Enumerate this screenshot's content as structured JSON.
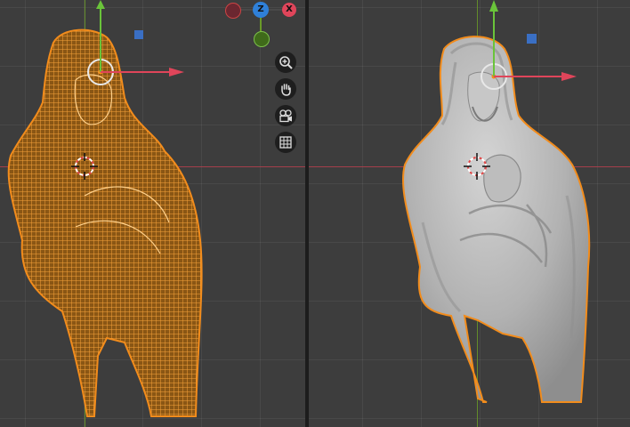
{
  "left_viewport": {
    "shading": "wireframe",
    "gizmo": {
      "z_label": "Z",
      "x_label": "X"
    },
    "nav_buttons": [
      {
        "name": "zoom-button",
        "icon": "zoom-icon"
      },
      {
        "name": "pan-button",
        "icon": "hand-icon"
      },
      {
        "name": "camera-view-button",
        "icon": "camera-icon"
      },
      {
        "name": "perspective-toggle-button",
        "icon": "grid-icon"
      }
    ]
  },
  "right_viewport": {
    "shading": "solid"
  },
  "colors": {
    "grid_bg": "#3d3d3d",
    "selection_orange": "#f28c1c",
    "axis_x": "#e0455a",
    "axis_y": "#6a9a28",
    "axis_z": "#2f80d8",
    "mesh_solid": "#b6b6b6",
    "panel_divider": "#1d1d1d"
  }
}
